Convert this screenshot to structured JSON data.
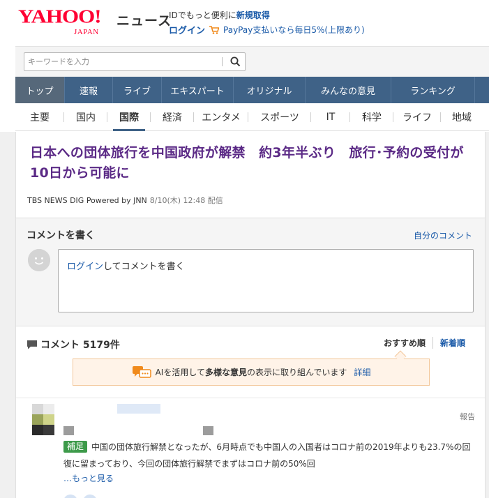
{
  "header": {
    "logo_text": "YAHOO!",
    "logo_sub": "JAPAN",
    "service_name": "ニュース",
    "promo_prefix": "IDでもっと便利に",
    "promo_link": "新規取得",
    "login_link": "ログイン",
    "paypay_text": "PayPay支払いなら毎日5%(上限あり)"
  },
  "search": {
    "placeholder": "キーワードを入力"
  },
  "main_nav": [
    {
      "label": "トップ",
      "active": true
    },
    {
      "label": "速報"
    },
    {
      "label": "ライブ"
    },
    {
      "label": "エキスパート"
    },
    {
      "label": "オリジナル"
    },
    {
      "label": "みんなの意見"
    },
    {
      "label": "ランキング"
    }
  ],
  "categories": [
    {
      "label": "主要"
    },
    {
      "label": "国内"
    },
    {
      "label": "国際",
      "active": true
    },
    {
      "label": "経済"
    },
    {
      "label": "エンタメ"
    },
    {
      "label": "スポーツ"
    },
    {
      "label": "IT"
    },
    {
      "label": "科学"
    },
    {
      "label": "ライフ"
    },
    {
      "label": "地域"
    }
  ],
  "article": {
    "title": "日本への団体旅行を中国政府が解禁　約3年半ぶり　旅行･予約の受付が10日から可能に",
    "source": "TBS NEWS DIG Powered by JNN",
    "date": "8/10(木) 12:48 配信"
  },
  "write": {
    "heading": "コメントを書く",
    "my_comments": "自分のコメント",
    "login_link": "ログイン",
    "login_suffix": "してコメントを書く"
  },
  "comments": {
    "count_label": "コメント 5179件",
    "sort_recommended": "おすすめ順",
    "sort_newest": "新着順",
    "ai_prefix": "AIを活用して",
    "ai_bold": "多様な意見",
    "ai_suffix": "の表示に取り組んでいます",
    "ai_detail": "詳細",
    "items": [
      {
        "report": "報告",
        "badge": "補足",
        "text": "中国の団体旅行解禁となったが、6月時点でも中国人の入国者はコロナ前の2019年よりも23.7%の回復に留まっており、今回の団体旅行解禁でまずはコロナ前の50%回",
        "more": "…もっと見る"
      }
    ]
  },
  "colors": {
    "brand_red": "#ff0033",
    "nav_blue": "#3f6287",
    "title_purple": "#5b2a86",
    "link_blue": "#1a5aa8",
    "badge_green": "#3d9a4a"
  }
}
